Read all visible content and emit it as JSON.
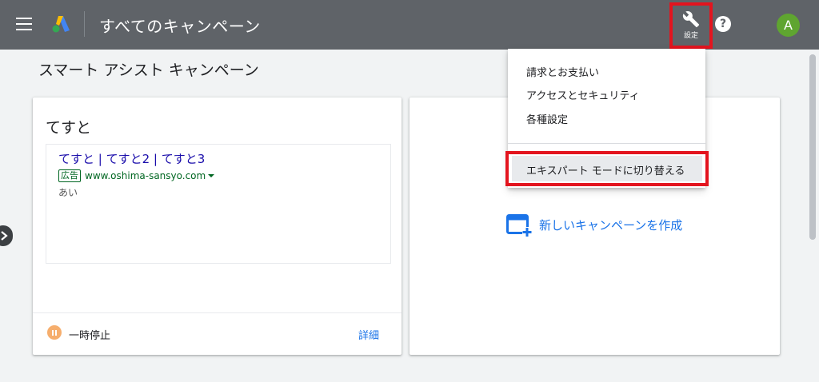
{
  "header": {
    "title": "すべてのキャンペーン",
    "settings_label": "設定",
    "help_glyph": "?",
    "avatar_letter": "A"
  },
  "page": {
    "subtitle": "スマート アシスト キャンペーン"
  },
  "campaign_card": {
    "title": "てすと",
    "ad": {
      "headline": "てすと | てすと2 | てすと3",
      "badge": "広告",
      "url": "www.oshima-sansyo.com",
      "description": "あい"
    },
    "status": "一時停止",
    "details_link": "詳細"
  },
  "new_campaign": {
    "label": "新しいキャンペーンを作成"
  },
  "settings_menu": {
    "items": [
      {
        "label": "請求とお支払い"
      },
      {
        "label": "アクセスとセキュリティ"
      },
      {
        "label": "各種設定"
      }
    ],
    "expert_mode": "エキスパート モードに切り替える"
  },
  "colors": {
    "topbar": "#5f6368",
    "highlight_red": "#e3141e",
    "link_blue": "#1a73e8",
    "ad_green": "#006621",
    "paused_orange": "#f6ae6d",
    "avatar_green": "#5fa530"
  },
  "icons": {
    "menu": "hamburger-menu-icon",
    "logo": "google-ads-logo-icon",
    "settings": "wrench-icon",
    "help": "help-circle-icon",
    "pause": "pause-icon",
    "new_campaign": "add-window-icon",
    "expand": "chevron-right-icon"
  }
}
